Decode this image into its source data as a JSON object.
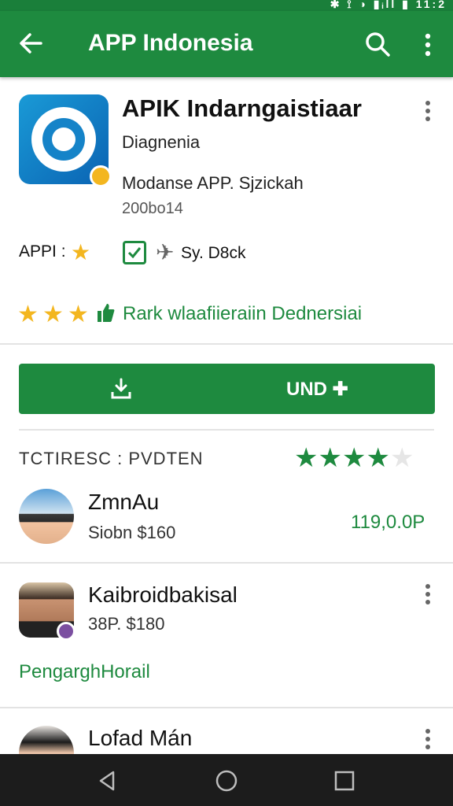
{
  "status_bar": {
    "icons_text": "✱ ⟟ ◑ ▮ᵢll ▮ 11:2"
  },
  "app_bar": {
    "title": "APP Indonesia",
    "back_icon": "arrow-left-icon",
    "search_icon": "search-icon",
    "more_icon": "more-vertical-icon"
  },
  "app": {
    "name": "APIK Indarngaistiaar",
    "developer": "Diagnenia",
    "subtitle": "Modanse APP. Sjzickah",
    "count": "200bo14"
  },
  "meta": {
    "label": "APPI :",
    "sy_text": "Sy. D8ck"
  },
  "rating_row": {
    "text": "Rark wlaafiieraiin Dednersiai"
  },
  "install": {
    "label": "UND ✚"
  },
  "reviews": {
    "header": "TCTIRESC : PVDTEN",
    "stars_filled": 4,
    "stars_total": 5
  },
  "reviewers": [
    {
      "name": "ZmnAu",
      "sub": "Siobn $160",
      "price": "119,0.0P"
    },
    {
      "name": "Kaibroidbakisal",
      "sub": "38P. $180",
      "link": "PengarghHorail"
    },
    {
      "name": "Lofad Mán"
    }
  ],
  "colors": {
    "primary": "#1e8a3f",
    "star": "#f3b61f",
    "nav": "#1c1c1c"
  }
}
